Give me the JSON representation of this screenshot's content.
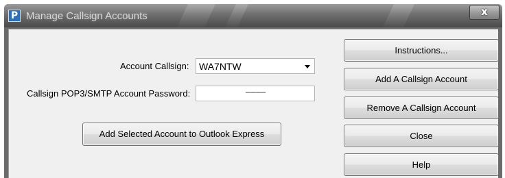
{
  "window": {
    "title": "Manage Callsign Accounts",
    "close_glyph": "x"
  },
  "icons": {
    "app": "app-logo-icon",
    "combo_arrow": "chevron-down-icon"
  },
  "form": {
    "callsign_label": "Account Callsign:",
    "callsign_value": "WA7NTW",
    "password_label": "Callsign POP3/SMTP Account Password:",
    "password_value": "-----------"
  },
  "buttons": {
    "add_to_outlook": "Add Selected Account to Outlook Express",
    "instructions": "Instructions...",
    "add_account": "Add A Callsign Account",
    "remove_account": "Remove A Callsign Account",
    "close": "Close",
    "help": "Help"
  },
  "colors": {
    "titlebar": "#6e6e6e",
    "client_bg": "#f0f0f0",
    "app_icon": "#2f6fb4"
  }
}
